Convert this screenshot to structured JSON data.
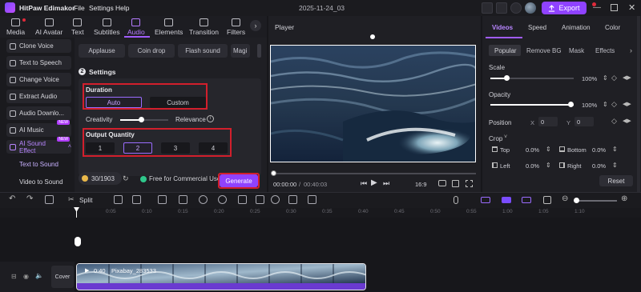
{
  "titlebar": {
    "app_name": "HitPaw Edimakor",
    "menu": [
      "File",
      "Settings",
      "Help"
    ],
    "project_title": "2025-11-24_03",
    "export_label": "Export"
  },
  "media_tabs": [
    "Media",
    "AI Avatar",
    "Text",
    "Subtitles",
    "Audio",
    "Elements",
    "Transition",
    "Filters"
  ],
  "sidebar": {
    "items": [
      "Clone Voice",
      "Text to Speech",
      "Change Voice",
      "Extract Audio",
      "Audio Downlo...",
      "AI Music",
      "AI Sound Effect"
    ],
    "badges": {
      "ai_music": "NEW",
      "ai_sound_effect": "NEW"
    },
    "subitems": [
      "Text to Sound",
      "Video to Sound"
    ]
  },
  "sound_panel": {
    "presets": [
      "Applause",
      "Coin drop",
      "Flash sound",
      "Magi"
    ],
    "step_number": "2",
    "settings_title": "Settings",
    "duration_title": "Duration",
    "duration_options": [
      "Auto",
      "Custom"
    ],
    "creativity_label": "Creativity",
    "relevance_label": "Relevance",
    "output_quantity_title": "Output Quantity",
    "quantity_options": [
      "1",
      "2",
      "3",
      "4"
    ],
    "selected_quantity": "2",
    "credits": "30/1903",
    "free_commercial": "Free for Commercial Use",
    "generate_label": "Generate"
  },
  "player": {
    "title": "Player",
    "current_time": "00:00:00",
    "separator": "/",
    "total_time": "00:40:03",
    "aspect": "16:9"
  },
  "right_panel": {
    "tabs": [
      "Videos",
      "Speed",
      "Animation",
      "Color"
    ],
    "subtabs": [
      "Popular",
      "Remove BG",
      "Mask",
      "Effects"
    ],
    "scale_label": "Scale",
    "scale_value": "100%",
    "opacity_label": "Opacity",
    "opacity_value": "100%",
    "position_label": "Position",
    "pos_x_label": "X",
    "pos_x": "0",
    "pos_y_label": "Y",
    "pos_y": "0",
    "crop_label": "Crop",
    "crop_top_label": "Top",
    "crop_top": "0.0%",
    "crop_bottom_label": "Bottom",
    "crop_bottom": "0.0%",
    "crop_left_label": "Left",
    "crop_left": "0.0%",
    "crop_right_label": "Right",
    "crop_right": "0.0%",
    "reset_label": "Reset"
  },
  "timeline": {
    "split_label": "Split",
    "ruler_ticks": [
      "0:05",
      "0:10",
      "0:15",
      "0:20",
      "0:25",
      "0:30",
      "0:35",
      "0:40",
      "0:45",
      "0:50",
      "0:55",
      "1:00",
      "1:05",
      "1:10"
    ],
    "cover_label": "Cover",
    "clip_duration": "0:40",
    "clip_name": "Pixabay_283533"
  },
  "colors": {
    "accent": "#8f42ff",
    "highlight_box": "#d21f2c",
    "panel_bg": "#1f1f24"
  }
}
